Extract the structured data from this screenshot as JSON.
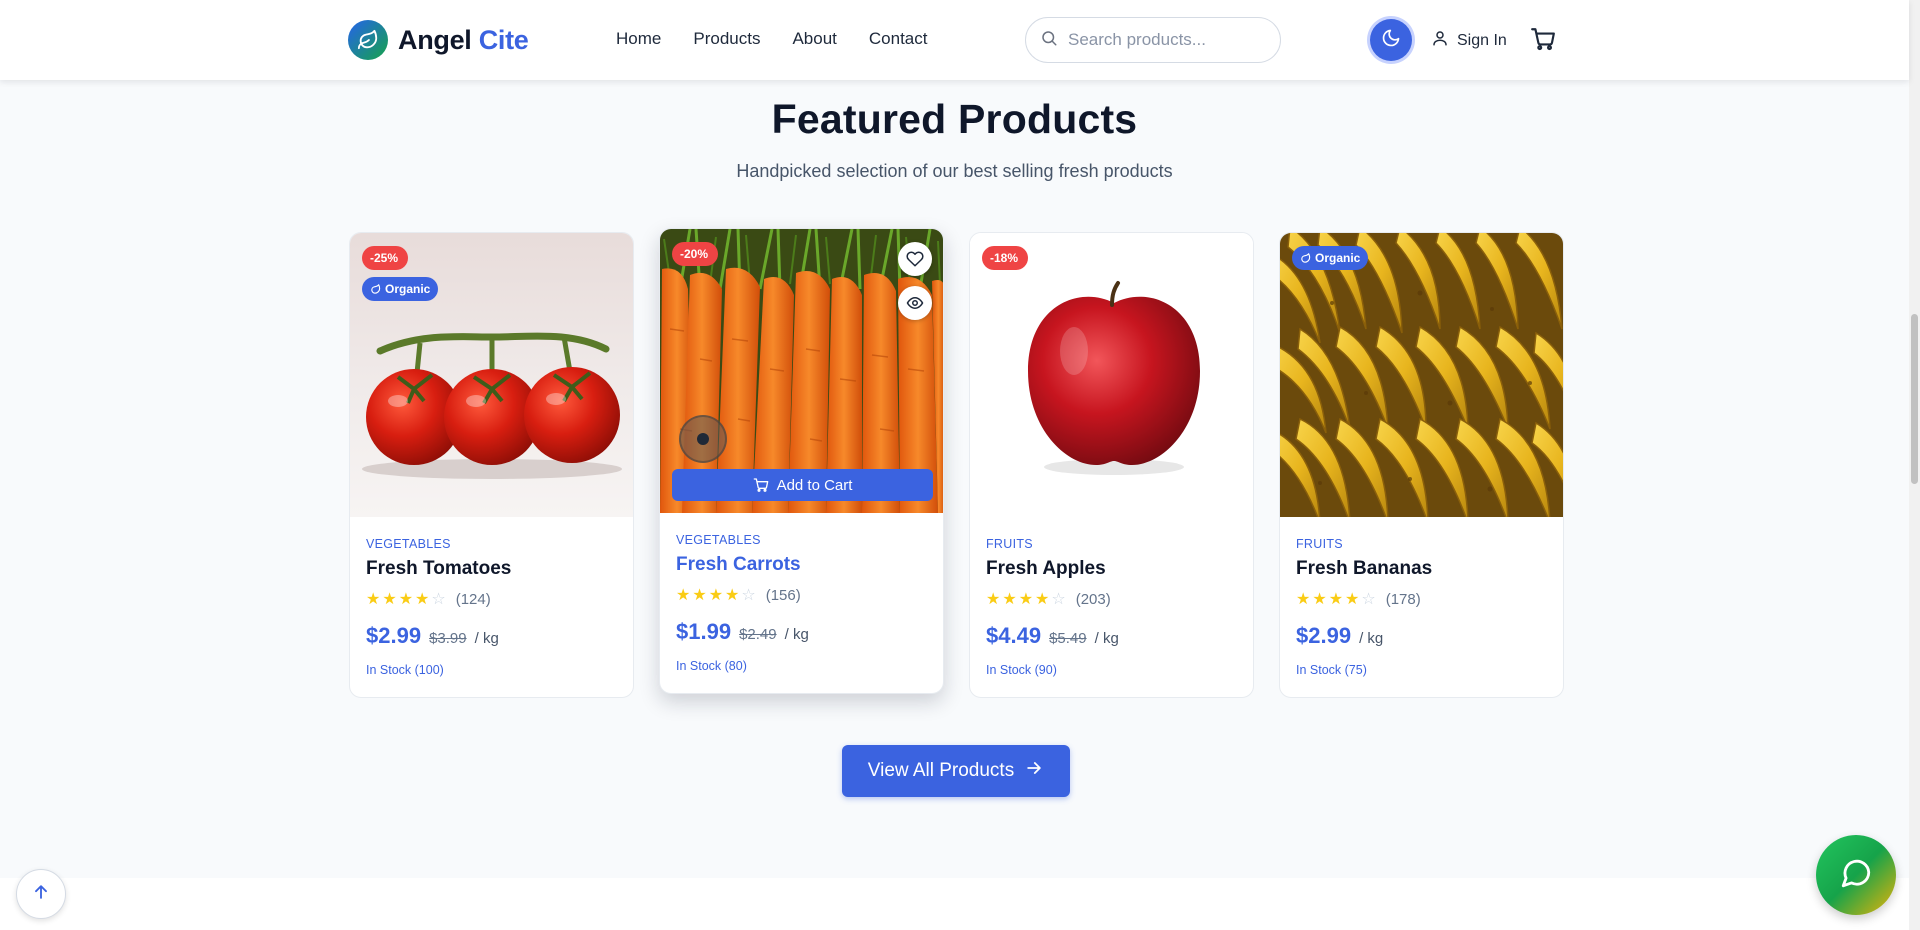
{
  "brand": {
    "name_part1": "Angel",
    "name_part2": "Cite",
    "logo_icon": "leaf-icon"
  },
  "nav": {
    "items": [
      {
        "label": "Home"
      },
      {
        "label": "Products"
      },
      {
        "label": "About"
      },
      {
        "label": "Contact"
      }
    ]
  },
  "search": {
    "placeholder": "Search products...",
    "value": ""
  },
  "header": {
    "signin_label": "Sign In",
    "theme_icon": "moon-icon",
    "cart_icon": "cart-icon"
  },
  "section": {
    "title": "Featured Products",
    "subtitle": "Handpicked selection of our best selling fresh products"
  },
  "products": [
    {
      "category": "VEGETABLES",
      "name": "Fresh Tomatoes",
      "rating": 4,
      "reviews": "(124)",
      "price": "$2.99",
      "old_price": "$3.99",
      "unit": "/ kg",
      "stock": "In Stock (100)",
      "discount": "-25%",
      "organic": "Organic"
    },
    {
      "category": "VEGETABLES",
      "name": "Fresh Carrots",
      "rating": 4,
      "reviews": "(156)",
      "price": "$1.99",
      "old_price": "$2.49",
      "unit": "/ kg",
      "stock": "In Stock (80)",
      "discount": "-20%",
      "add_to_cart": "Add to Cart"
    },
    {
      "category": "FRUITS",
      "name": "Fresh Apples",
      "rating": 4,
      "reviews": "(203)",
      "price": "$4.49",
      "old_price": "$5.49",
      "unit": "/ kg",
      "stock": "In Stock (90)",
      "discount": "-18%"
    },
    {
      "category": "FRUITS",
      "name": "Fresh Bananas",
      "rating": 4,
      "reviews": "(178)",
      "price": "$2.99",
      "unit": "/ kg",
      "stock": "In Stock (75)",
      "organic": "Organic"
    }
  ],
  "cta": {
    "view_all_label": "View All Products"
  },
  "colors": {
    "primary": "#3b63e0",
    "discount": "#ef4444",
    "star": "#facc15"
  }
}
